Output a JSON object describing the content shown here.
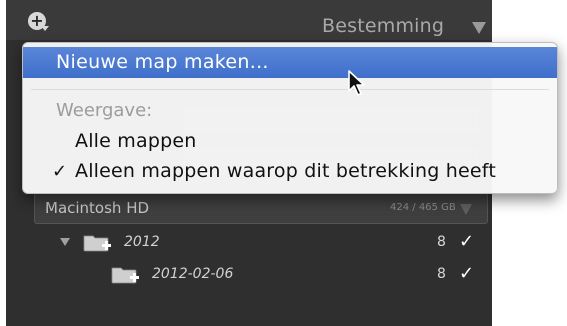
{
  "panel": {
    "title": "Bestemming",
    "add_button_icon": "plus-icon",
    "title_caret_icon": "triangle-down-icon"
  },
  "menu": {
    "items": [
      {
        "label": "Nieuwe map maken...",
        "highlighted": true
      },
      {
        "section_label": "Weergave:"
      },
      {
        "label": "Alle mappen",
        "checked": false
      },
      {
        "label": "Alleen mappen waarop dit betrekking heeft",
        "checked": true,
        "check_mark": "✓"
      }
    ]
  },
  "volume": {
    "name": "Macintosh HD",
    "size": "424 / 465 GB",
    "caret_icon": "triangle-down-icon"
  },
  "folders": [
    {
      "name": "2012",
      "count": "8",
      "check": "✓",
      "expanded": true,
      "icon": "folder-plus-icon"
    },
    {
      "name": "2012-02-06",
      "count": "8",
      "check": "✓",
      "icon": "folder-plus-icon"
    }
  ],
  "colors": {
    "menu_highlight": "#4b79d1",
    "panel_background": "#2f2f2f",
    "menu_background": "#f8f8f8"
  },
  "cursor_icon": "arrow-cursor-icon"
}
